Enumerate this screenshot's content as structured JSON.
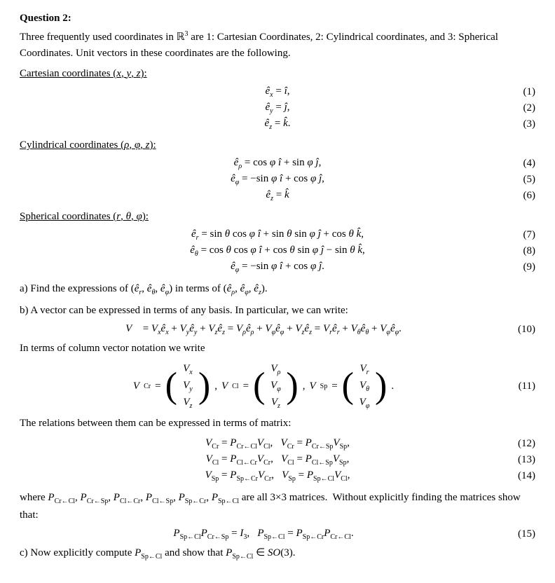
{
  "question": {
    "title": "Question 2:",
    "intro": "Three frequently used coordinates in ℝ³ are 1: Cartesian Coordinates, 2: Cylindrical coordinates, and 3: Spherical Coordinates. Unit vectors in these coordinates are the following.",
    "sections": {
      "cartesian": {
        "title": "Cartesian coordinates (x, y, z):",
        "equations": [
          {
            "lhs": "ê_x = î,",
            "number": "(1)"
          },
          {
            "lhs": "ê_y = ĵ,",
            "number": "(2)"
          },
          {
            "lhs": "ê_z = k̂.",
            "number": "(3)"
          }
        ]
      },
      "cylindrical": {
        "title": "Cylindrical coordinates (ρ, φ, z):",
        "equations": [
          {
            "lhs": "ê_ρ = cos φ î + sin φ ĵ,",
            "number": "(4)"
          },
          {
            "lhs": "ê_φ = −sin φ î + cos φ ĵ,",
            "number": "(5)"
          },
          {
            "lhs": "ê_z = k̂",
            "number": "(6)"
          }
        ]
      },
      "spherical": {
        "title": "Spherical coordinates (r, θ, φ):",
        "equations": [
          {
            "lhs": "ê_r = sin θ cos φ î + sin θ sin φ ĵ + cos θ k̂,",
            "number": "(7)"
          },
          {
            "lhs": "ê_θ = cos θ cos φ î + cos θ sin φ ĵ − sin θ k̂,",
            "number": "(8)"
          },
          {
            "lhs": "ê_φ = −sin φ î + cos φ ĵ.",
            "number": "(9)"
          }
        ]
      }
    },
    "part_a": "a) Find the expressions of (ê_r, ê_θ, ê_φ) in terms of (ê_ρ, ê_φ, ê_z).",
    "part_b_intro": "b) A vector can be expressed in terms of any basis. In particular, we can write:",
    "eq10": "V⃗ = V_x ê_x + V_y ê_y + V_z ê_z = V_ρ ê_ρ + V_φ ê_φ + V_z ê_z = V_r ê_r + V_θ ê_θ + V_φ ê_φ.",
    "eq10_num": "(10)",
    "col_vector_intro": "In terms of column vector notation we write",
    "eq11_num": "(11)",
    "matrix_labels": {
      "vcr": "V_Cr",
      "vcl": "V_Cl",
      "vsp": "V_Sp"
    },
    "matrix_vcr": [
      "V_x",
      "V_y",
      "V_z"
    ],
    "matrix_vcl": [
      "V_ρ",
      "V_φ",
      "V_z"
    ],
    "matrix_vsp": [
      "V_r",
      "V_θ",
      "V_φ"
    ],
    "relations_intro": "The relations between them can be expressed in terms of matrix:",
    "eq12": "V_Cr = P_{Cr←Cl} V_Cl,   V_Cr = P_{Cr←Sp} V_Sp,",
    "eq12_num": "(12)",
    "eq13": "V_Cl = P_{Cl←Cr} V_Cr,   V_Cl = P_{Cl←Sp} V_Sp,",
    "eq13_num": "(13)",
    "eq14": "V_Sp = P_{Sp←Cr} V_Cr,   V_Sp = P_{Sp←Cl} V_Cl,",
    "eq14_num": "(14)",
    "where_text": "where P_{Cr←Cl}, P_{Cr←Sp}, P_{Cl←Cr}, P_{Cl←Sp}, P_{Sp←Cr}, P_{Sp←Cl} are all 3×3 matrices.  Without explicitly finding the matrices show that:",
    "eq15": "P_{Sp←Cl} P_{Cr←Sp} = I_3,   P_{Sp←Cl} = P_{Sp←Cr} P_{Cr←Cl}.",
    "eq15_num": "(15)",
    "part_c": "c) Now explicitly compute P_{Sp←Cl} and show that P_{Sp←Cl} ∈ SO(3)."
  }
}
